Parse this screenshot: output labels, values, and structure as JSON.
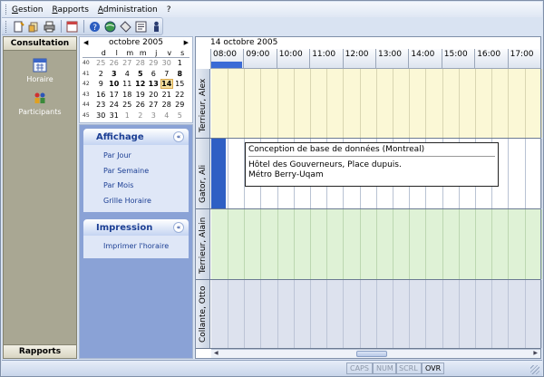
{
  "menubar": {
    "items": [
      "Gestion",
      "Rapports",
      "Administration",
      "?"
    ]
  },
  "toolbar": {
    "icons": [
      "new-icon",
      "open-icon",
      "print-icon",
      "calendar-icon",
      "help-icon",
      "globe-icon",
      "tag-icon",
      "note-icon",
      "exit-icon"
    ]
  },
  "nav": {
    "header": "Consultation",
    "entries": [
      {
        "label": "Horaire",
        "icon": "calendar-icon"
      },
      {
        "label": "Participants",
        "icon": "people-icon"
      }
    ],
    "footer": "Rapports"
  },
  "calendar": {
    "month": "octobre 2005",
    "dow": [
      "d",
      "l",
      "m",
      "m",
      "j",
      "v",
      "s"
    ],
    "weeks": [
      {
        "wk": "40",
        "days": [
          "25",
          "26",
          "27",
          "28",
          "29",
          "30",
          "1"
        ]
      },
      {
        "wk": "41",
        "days": [
          "2",
          "3",
          "4",
          "5",
          "6",
          "7",
          "8"
        ]
      },
      {
        "wk": "42",
        "days": [
          "9",
          "10",
          "11",
          "12",
          "13",
          "14",
          "15"
        ]
      },
      {
        "wk": "43",
        "days": [
          "16",
          "17",
          "18",
          "19",
          "20",
          "21",
          "22"
        ]
      },
      {
        "wk": "44",
        "days": [
          "23",
          "24",
          "25",
          "26",
          "27",
          "28",
          "29"
        ]
      },
      {
        "wk": "45",
        "days": [
          "30",
          "31",
          "1",
          "2",
          "3",
          "4",
          "5"
        ]
      }
    ],
    "today": "14"
  },
  "affichage": {
    "title": "Affichage",
    "links": [
      "Par Jour",
      "Par Semaine",
      "Par Mois",
      "Grille Horaire"
    ]
  },
  "impression": {
    "title": "Impression",
    "links": [
      "Imprimer l'horaire"
    ]
  },
  "scheduler": {
    "date": "14 octobre 2005",
    "times": [
      "08:00",
      "09:00",
      "10:00",
      "11:00",
      "12:00",
      "13:00",
      "14:00",
      "15:00",
      "16:00",
      "17:00"
    ],
    "rows": [
      {
        "name": "Terrieur, Alex",
        "bg": "#fbf8d6",
        "line": "#d9d6b2"
      },
      {
        "name": "Gator, Ali",
        "bg": "#ffffff",
        "line": "#b9c3d3"
      },
      {
        "name": "Terrieur, Alain",
        "bg": "#dff2d6",
        "line": "#bcd7b1"
      },
      {
        "name": "Collante, Otto",
        "bg": "#dde2ee",
        "line": "#bcc4d6"
      }
    ],
    "appointment": {
      "title": "Conception de base de données (Montreal)",
      "line1": "Hôtel des Gouverneurs, Place dupuis.",
      "line2": "Métro Berry-Uqam"
    }
  },
  "status": {
    "caps": "CAPS",
    "num": "NUM",
    "scrl": "SCRL",
    "ovr": "OVR"
  }
}
